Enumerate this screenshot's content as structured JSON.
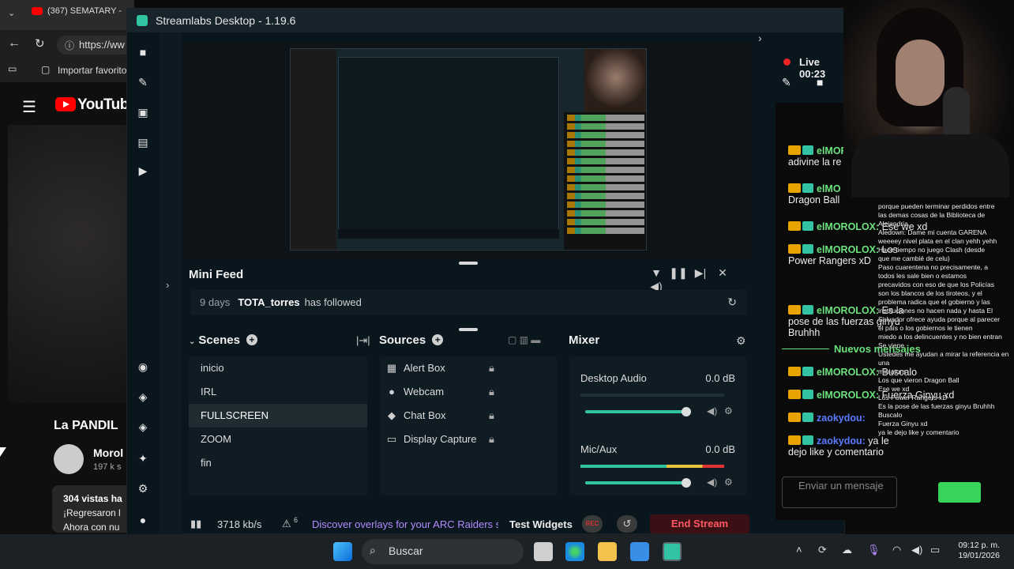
{
  "browser": {
    "tab_title": "(367) SEMATARY -",
    "url": "https://ww",
    "bookmark": "Importar favorito",
    "yt_logo": "YouTube",
    "channel_title": "La PANDIL",
    "channel_name": "Morol",
    "subs": "197 k s",
    "views": "304 vistas  ha",
    "desc1": "¡Regresaron l",
    "desc2": "Ahora con nu"
  },
  "streamlabs": {
    "title": "Streamlabs Desktop - 1.19.6",
    "live_label": "Live 00:23",
    "minifeed": {
      "heading": "Mini Feed",
      "age": "9 days",
      "user": "TOTA_torres",
      "action": "has followed"
    },
    "scenes": {
      "heading": "Scenes",
      "items": [
        "inicio",
        "IRL",
        "FULLSCREEN",
        "ZOOM",
        "fin"
      ],
      "active_index": 2
    },
    "sources": {
      "heading": "Sources",
      "items": [
        {
          "label": "Alert Box",
          "icon": "bell-icon"
        },
        {
          "label": "Webcam",
          "icon": "webcam-icon"
        },
        {
          "label": "Chat Box",
          "icon": "chat-icon"
        },
        {
          "label": "Display Capture",
          "icon": "monitor-icon"
        }
      ]
    },
    "mixer": {
      "heading": "Mixer",
      "channels": [
        {
          "name": "Desktop Audio",
          "db": "0.0 dB"
        },
        {
          "name": "Mic/Aux",
          "db": "0.0 dB"
        }
      ]
    },
    "status": {
      "bitrate": "3718 kb/s",
      "alerts": "6",
      "promo": "Discover overlays for your ARC Raiders s",
      "test_widgets": "Test Widgets",
      "rec": "REC",
      "end_stream": "End Stream"
    }
  },
  "chat": {
    "messages": [
      {
        "user": "elMORO",
        "text": "adivine la re"
      },
      {
        "user": "elMO",
        "text": "Dragon Ball"
      },
      {
        "user": "elMOROLOX:",
        "text": "Ese we xd"
      },
      {
        "user": "elMOROLOX:",
        "text": "Los Power Rangers xD"
      },
      {
        "user": "elMOROLOX:",
        "text": "Es la pose de las fuerzas ginyu Bruhhh"
      },
      {
        "user": "elMOROLOX:",
        "text": "Buscalo"
      },
      {
        "user": "elMOROLOX:",
        "text": "Fuerza Ginyu xd"
      },
      {
        "user": "zaokydou:",
        "text": ""
      },
      {
        "user": "zaokydou:",
        "text": "ya le dejo like y comentario"
      }
    ],
    "new_messages": "Nuevos mensajes",
    "input_placeholder": "Enviar un mensaje"
  },
  "overlay_lines": [
    "porque pueden terminar perdidos entre",
    "las demas cosas de la Biblioteca de",
    "Alejandria",
    "Aledown: Dame mi cuenta GARENA",
    "weeeey nivel plata en el clan yehh yehh",
    "Hace tiempo no juego Clash (desde",
    "que me cambié de celu)",
    "Paso cuarentena no precisamente, a",
    "todos les sale bien o estamos",
    "precavidos con eso de que los Policías",
    "son los blancos de los tiroteos, y el",
    "problema radica que el gobierno y las",
    "instituciones no hacen nada y hasta El",
    "Salvador ofrece ayuda porque al parecer",
    "el país o los gobiernos le tienen",
    "miedo a los delincuentes y no bien entran",
    "Se viene",
    "Ustedes me ayudan a mirar la referencia en una",
    "miniatura",
    "Los que vieron Dragon Ball",
    "Ese we xd",
    "Los Power Rangers xD",
    "Es la pose de las fuerzas ginyu Bruhhh",
    "Buscalo",
    "Fuerza Ginyu xd",
    "ya le dejo like y comentario"
  ],
  "taskbar": {
    "search_placeholder": "Buscar",
    "time": "09:12 p. m.",
    "date": "19/01/2026"
  },
  "colors": {
    "accent": "#31c3a2",
    "end_stream": "#ff5a64",
    "chat_user": "#6ce27d",
    "promo": "#b58cff"
  }
}
